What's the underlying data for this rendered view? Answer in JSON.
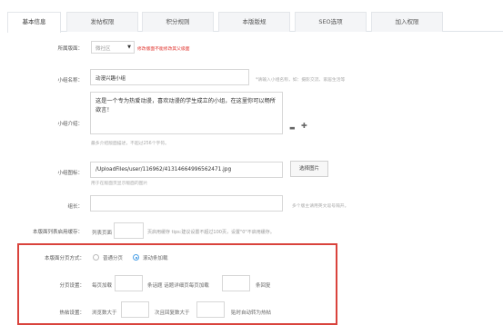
{
  "tabs": [
    {
      "label": "基本信息",
      "active": true
    },
    {
      "label": "发帖权限"
    },
    {
      "label": "积分规则"
    },
    {
      "label": "本版版规"
    },
    {
      "label": "SEO选项"
    },
    {
      "label": "加入权限"
    }
  ],
  "form": {
    "parent": {
      "label": "所属版面：",
      "value": "微社区",
      "warning": "修改版面不能修改其父级面"
    },
    "name": {
      "label": "小组名称：",
      "value": "动漫兴趣小组",
      "hint": "*请输入小组名称，如：摄影交流、家居生活等"
    },
    "intro": {
      "label": "小组介绍：",
      "value": "这是一个专为热爱动漫，喜欢动漫的学生成立的小组，在这里你可以畅所欲言！",
      "hint": "最多介绍版面描述，不超过256个字符。"
    },
    "icon": {
      "label": "小组图标：",
      "value": "/UploadFiles/user/116962/413146649965624​71.jpg",
      "button": "选择图片",
      "hint": "用于在版面页显示版面的图片"
    },
    "moderator": {
      "label": "组长：",
      "value": "",
      "hint": "多个版主请用英文逗号隔开。"
    },
    "cache": {
      "label": "本版面列表启用缓存：",
      "prefix": "列表页面",
      "value": "",
      "suffix": "页启用缓存 tips:建议设置不超过100页，设置\"0\"不启用缓存。"
    },
    "paging": {
      "label": "本版面分页方式：",
      "options": [
        "普通分页",
        "滚动条加载"
      ],
      "selected": 1
    },
    "page_settings": {
      "label": "分页设置：",
      "t1": "每页加载",
      "v1": "",
      "t2": "条话题  话题详细页每页加载",
      "v2": "",
      "t3": "条回复"
    },
    "hot": {
      "label": "热帖设置：",
      "t1": "浏览数大于",
      "v1": "",
      "t2": "次且回复数大于",
      "v2": "",
      "t3": "贴时自动转为热帖"
    }
  }
}
